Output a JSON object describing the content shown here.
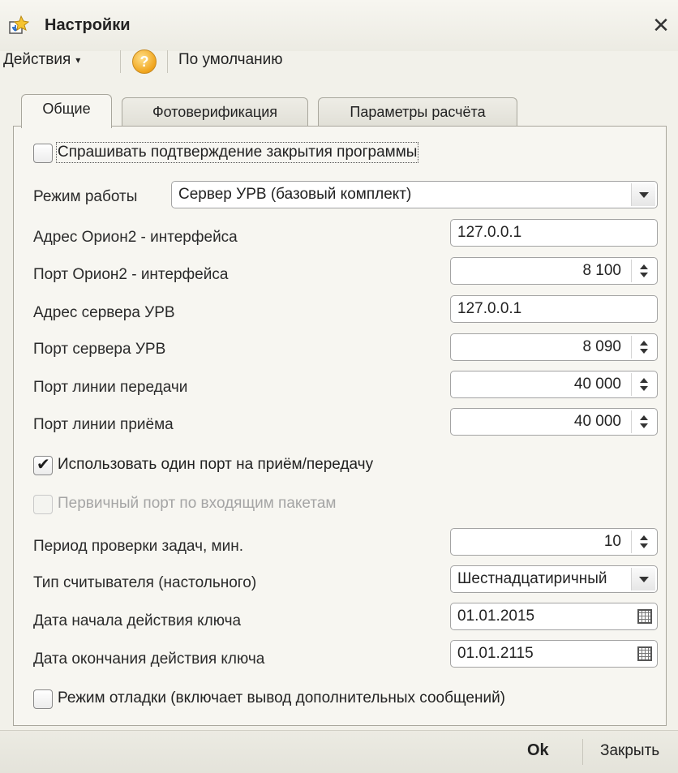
{
  "window": {
    "title": "Настройки",
    "close_glyph": "✕"
  },
  "toolbar": {
    "actions_label": "Действия",
    "actions_arrow": "▾",
    "help_glyph": "?",
    "default_label": "По умолчанию"
  },
  "tabs": [
    {
      "label": "Общие",
      "active": true
    },
    {
      "label": "Фотоверификация",
      "active": false
    },
    {
      "label": "Параметры расчёта",
      "active": false
    }
  ],
  "form": {
    "confirm_close": {
      "label": "Спрашивать подтверждение закрытия программы",
      "checked": false
    },
    "mode": {
      "label": "Режим работы",
      "value": "Сервер УРВ (базовый комплект)"
    },
    "orion_address": {
      "label": "Адрес Орион2 - интерфейса",
      "value": "127.0.0.1"
    },
    "orion_port": {
      "label": "Порт Орион2 - интерфейса",
      "value": "8 100"
    },
    "server_address": {
      "label": "Адрес сервера УРВ",
      "value": "127.0.0.1"
    },
    "server_port": {
      "label": "Порт сервера УРВ",
      "value": "8 090"
    },
    "tx_port": {
      "label": "Порт линии передачи",
      "value": "40 000"
    },
    "rx_port": {
      "label": "Порт линии приёма",
      "value": "40 000"
    },
    "single_port": {
      "label": "Использовать один порт на приём/передачу",
      "checked": true
    },
    "primary_port": {
      "label": "Первичный порт по входящим пакетам",
      "checked": false,
      "disabled": true
    },
    "check_period": {
      "label": "Период проверки задач, мин.",
      "value": "10"
    },
    "reader_type": {
      "label": "Тип считывателя (настольного)",
      "value": "Шестнадцатиричный"
    },
    "key_start": {
      "label": "Дата начала действия ключа",
      "value": "01.01.2015"
    },
    "key_end": {
      "label": "Дата окончания действия ключа",
      "value": "01.01.2115"
    },
    "debug_mode": {
      "label": "Режим отладки (включает вывод дополнительных сообщений)",
      "checked": false
    }
  },
  "footer": {
    "ok_label": "Ok",
    "close_label": "Закрыть"
  },
  "icons": {
    "title_icon": "settings-window-icon",
    "spin": "spinner-arrows-icon",
    "dropdown": "chevron-down-icon",
    "calendar": "calendar-icon",
    "checkmark": "checkmark-icon"
  },
  "colors": {
    "window_bg": "#f2f1ea",
    "panel_bg": "#f7f6f1",
    "help_icon": "#f0a41c",
    "disabled_text": "#a5a5a5"
  }
}
